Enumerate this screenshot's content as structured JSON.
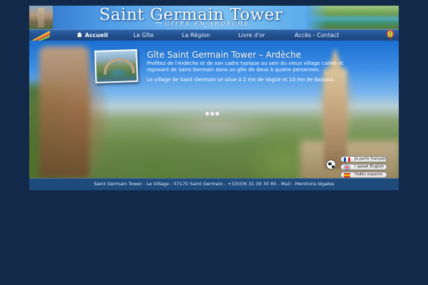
{
  "header": {
    "title": "Saint Germain Tower",
    "subtitle": "GÎTES EN ARDÈCHE"
  },
  "nav": {
    "items": [
      {
        "label": "Accueil",
        "active": true
      },
      {
        "label": "Le Gîte"
      },
      {
        "label": "La Région"
      },
      {
        "label": "Livre d'or"
      },
      {
        "label": "Accès - Contact"
      }
    ]
  },
  "hero": {
    "title": "Gîte Saint Germain Tower – Ardèche",
    "description1": "Profitez de l'Ardèche et de son cadre typique au sein du vieux village calme et reposant de Saint Germain dans un gîte de deux à quatre personnes.",
    "description2": "Le village de Saint Germain se situe à 2 mn de Vogüé et 10 mn de Balazuc.",
    "slider_dots": 3
  },
  "languages": [
    {
      "label": "Je parle français",
      "flag": "flag-fr-icon"
    },
    {
      "label": "I speak English",
      "flag": "flag-uk-icon"
    },
    {
      "label": "Hablo español",
      "flag": "flag-es-icon"
    }
  ],
  "footer": {
    "text": "Saint Germain Tower - Le Village - 07170 Saint Germain - +33(0)6 31 39 30 85 - Mail - Mentions légales"
  },
  "colors": {
    "page_background": "#12294a",
    "nav_background": "#224f8d",
    "footer_background": "#1f4a7c"
  }
}
